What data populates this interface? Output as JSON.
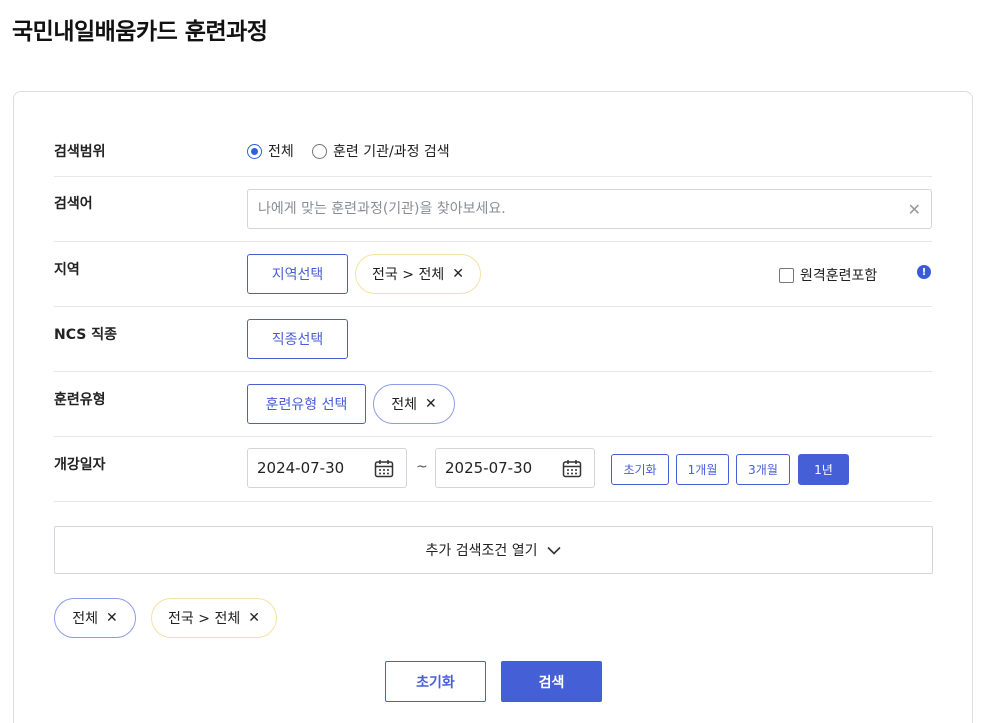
{
  "page": {
    "title": "국민내일배움카드 훈련과정"
  },
  "search_scope": {
    "label": "검색범위",
    "options": [
      {
        "label": "전체",
        "selected": true
      },
      {
        "label": "훈련 기관/과정 검색",
        "selected": false
      }
    ]
  },
  "keyword": {
    "label": "검색어",
    "placeholder": "나에게 맞는 훈련과정(기관)을 찾아보세요.",
    "value": "",
    "clear_icon": "close-icon",
    "clear_glyph": "✕"
  },
  "region": {
    "label": "지역",
    "select_button": "지역선택",
    "chip": "전국 > 전체",
    "remote_label": "원격훈련포함",
    "remote_checked": false,
    "info_icon": "info-icon",
    "info_glyph": "!"
  },
  "ncs": {
    "label": "NCS 직종",
    "select_button": "직종선택"
  },
  "training_type": {
    "label": "훈련유형",
    "select_button": "훈련유형 선택",
    "chip": "전체"
  },
  "start_date": {
    "label": "개강일자",
    "from": "2024-07-30",
    "separator": "~",
    "to": "2025-07-30",
    "calendar_icon": "calendar-icon",
    "quick_buttons": [
      {
        "label": "초기화",
        "active": false
      },
      {
        "label": "1개월",
        "active": false
      },
      {
        "label": "3개월",
        "active": false
      },
      {
        "label": "1년",
        "active": true
      }
    ]
  },
  "more_filters": {
    "label": "추가 검색조건 열기",
    "icon": "chevron-down-icon"
  },
  "selected_chips": [
    {
      "label": "전체",
      "style": "blue"
    },
    {
      "label": "전국 > 전체",
      "style": "yellow"
    }
  ],
  "chip_remove_glyph": "✕",
  "actions": {
    "reset": "초기화",
    "search": "검색"
  },
  "colors": {
    "accent": "#4560d6",
    "radio": "#2f62d9",
    "chip_yellow_border": "#f2e2a6",
    "chip_blue_border": "#8c9ce6",
    "border": "#d3d5db"
  }
}
